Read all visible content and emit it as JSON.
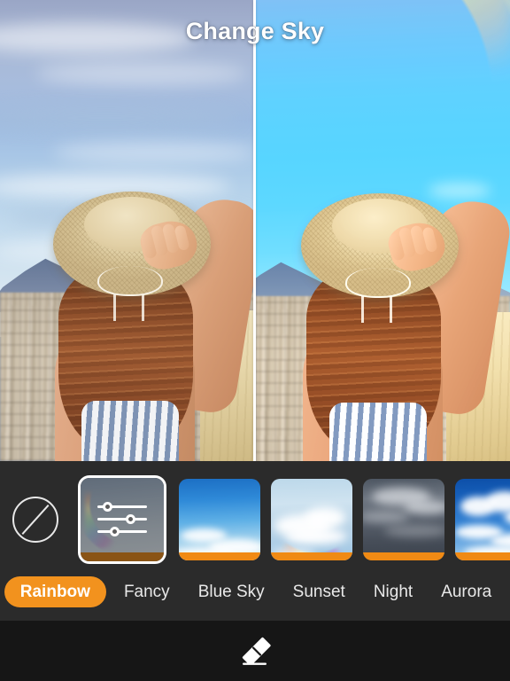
{
  "header": {
    "title": "Change Sky"
  },
  "compare": {
    "divider_label": "before-after-divider",
    "left_label": "original photo",
    "right_label": "edited photo with rainbow sky"
  },
  "colors": {
    "accent": "#F2921E",
    "thumb_bar": "#F08A14",
    "panel_bg": "#2B2B2B",
    "bottom_bg": "#161616",
    "text": "#FFFFFF"
  },
  "effects_strip": {
    "none_label": "none-icon",
    "items": [
      {
        "name": "adjust",
        "icon": "sliders-icon",
        "selected": true,
        "bar": "#8A5415"
      },
      {
        "name": "rainbow-arc-sky",
        "icon": "sky-thumbnail",
        "selected": false,
        "bar": "#F08A14"
      },
      {
        "name": "cloud-rainbow-sky",
        "icon": "sky-thumbnail",
        "selected": false,
        "bar": "#F08A14"
      },
      {
        "name": "storm-rainbow-sky",
        "icon": "sky-thumbnail",
        "selected": false,
        "bar": "#F08A14"
      },
      {
        "name": "blue-cloud-sky",
        "icon": "sky-thumbnail",
        "selected": false,
        "bar": "#F08A14"
      }
    ]
  },
  "categories": {
    "selected": "Rainbow",
    "items": [
      {
        "label": "Rainbow",
        "active": true
      },
      {
        "label": "Fancy",
        "active": false
      },
      {
        "label": "Blue Sky",
        "active": false
      },
      {
        "label": "Sunset",
        "active": false
      },
      {
        "label": "Night",
        "active": false
      },
      {
        "label": "Aurora",
        "active": false
      }
    ]
  },
  "toolbar": {
    "eraser_label": "eraser-tool"
  }
}
